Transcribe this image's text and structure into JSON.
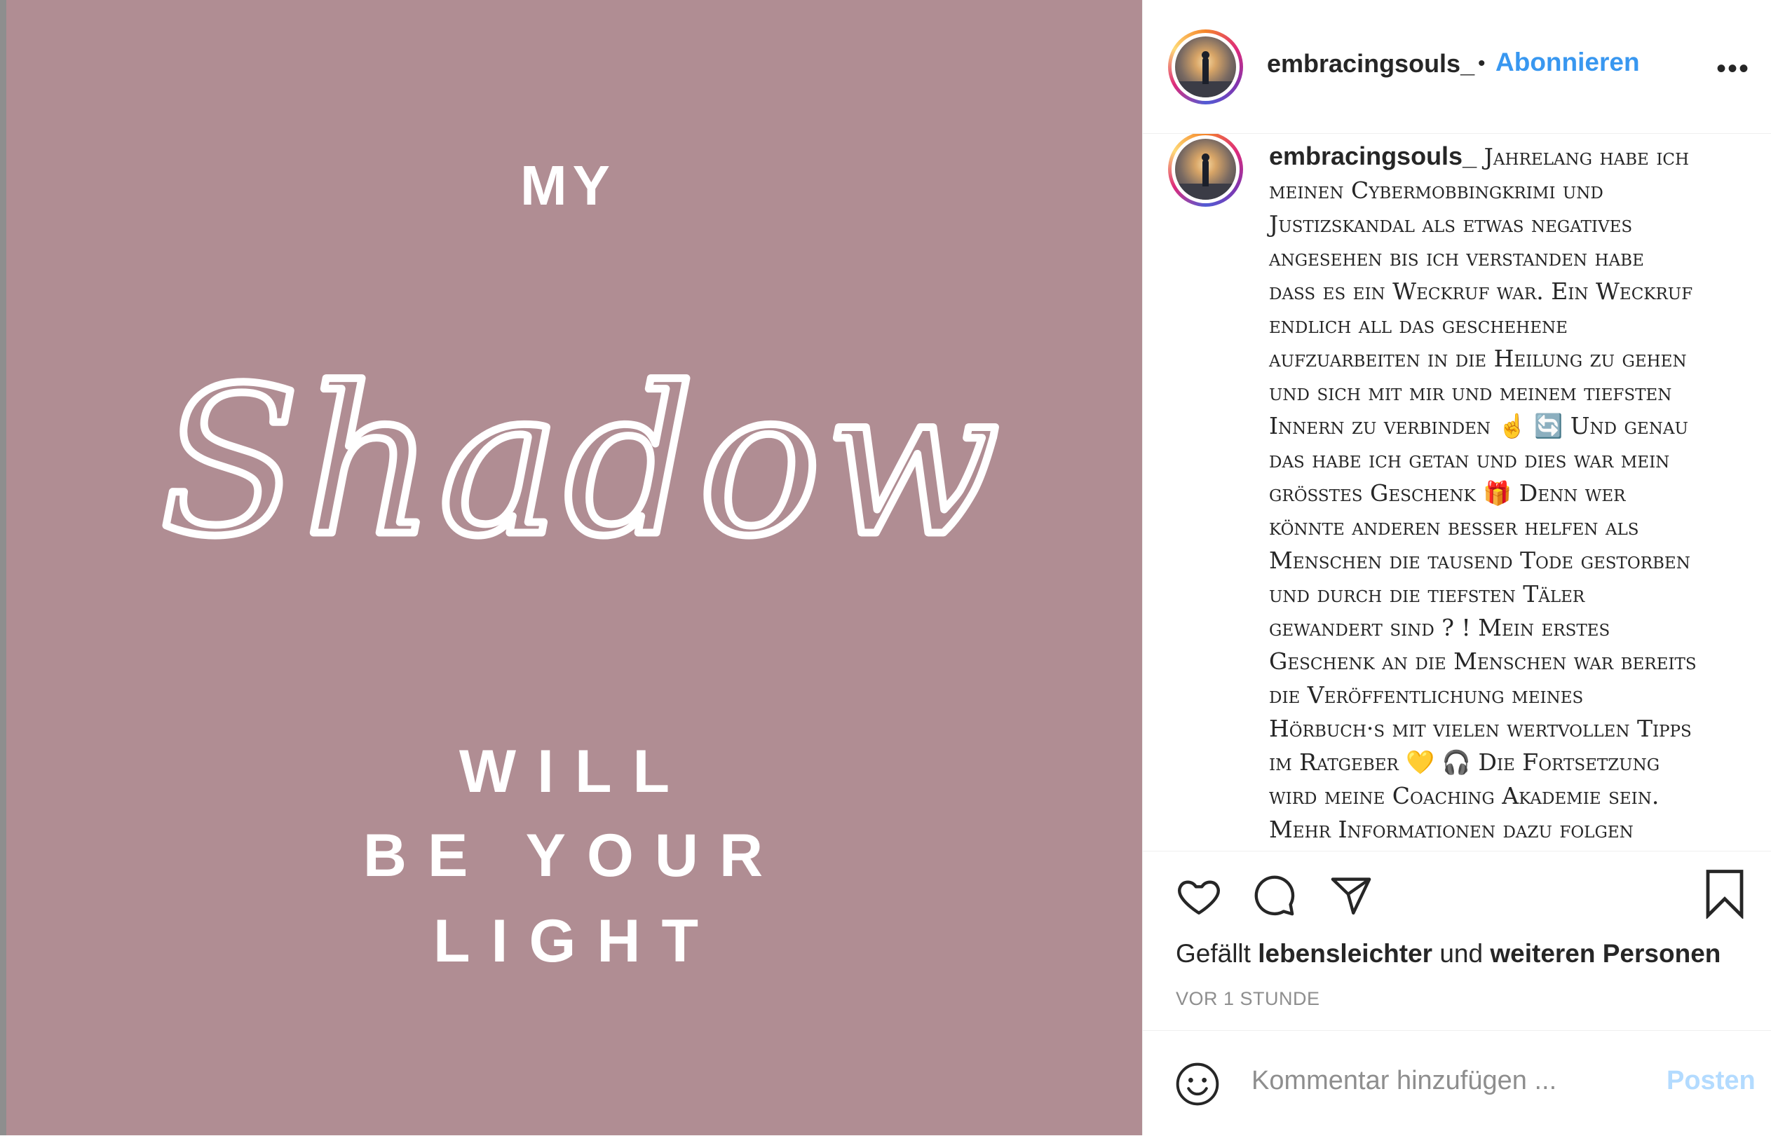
{
  "image": {
    "line1": "MY",
    "script_word": "Shadow",
    "line3": "WILL",
    "line4": "BE YOUR",
    "line5": "LIGHT",
    "background_color": "#b08d93",
    "text_color": "#ffffff"
  },
  "header": {
    "username": "embracingsouls_",
    "separator": "•",
    "follow_label": "Abonnieren",
    "more_label": "•••"
  },
  "caption": {
    "username": "embracingsouls_",
    "lines": [
      "Jahrelang habe ich",
      "meinen Cybermobbingkrimi und",
      "Justizskandal als etwas negatives",
      "angesehen bis ich verstanden habe",
      "dass es ein Weckruf war. Ein Weckruf",
      "endlich all das geschehene",
      "aufzuarbeiten in die Heilung zu gehen",
      "und sich mit mir und meinem tiefsten",
      "Innern zu verbinden ☝ 🔄 Und genau",
      "das habe ich getan und dies war mein",
      "größtes Geschenk 🎁 Denn wer",
      "könnte anderen besser helfen als",
      "Menschen die tausend Tode gestorben",
      "und durch die tiefsten Täler",
      "gewandert sind ?  !  Mein erstes",
      "Geschenk an die Menschen war bereits",
      "die Veröffentlichung meines",
      "Hörbuch·s mit vielen wertvollen Tipps",
      "im Ratgeber 💛 🎧 Die Fortsetzung",
      "wird meine Coaching Akademie sein.",
      "Mehr Informationen dazu folgen"
    ]
  },
  "actions": {
    "like_icon": "heart-icon",
    "comment_icon": "comment-icon",
    "share_icon": "paper-plane-icon",
    "save_icon": "bookmark-icon"
  },
  "likes": {
    "prefix": "Gefällt",
    "user": "lebensleichter",
    "middle": "und",
    "others": "weiteren Personen"
  },
  "timestamp": "VOR 1 STUNDE",
  "comment": {
    "emoji_icon": "smiley-icon",
    "placeholder": "Kommentar hinzufügen ...",
    "post_label": "Posten"
  }
}
